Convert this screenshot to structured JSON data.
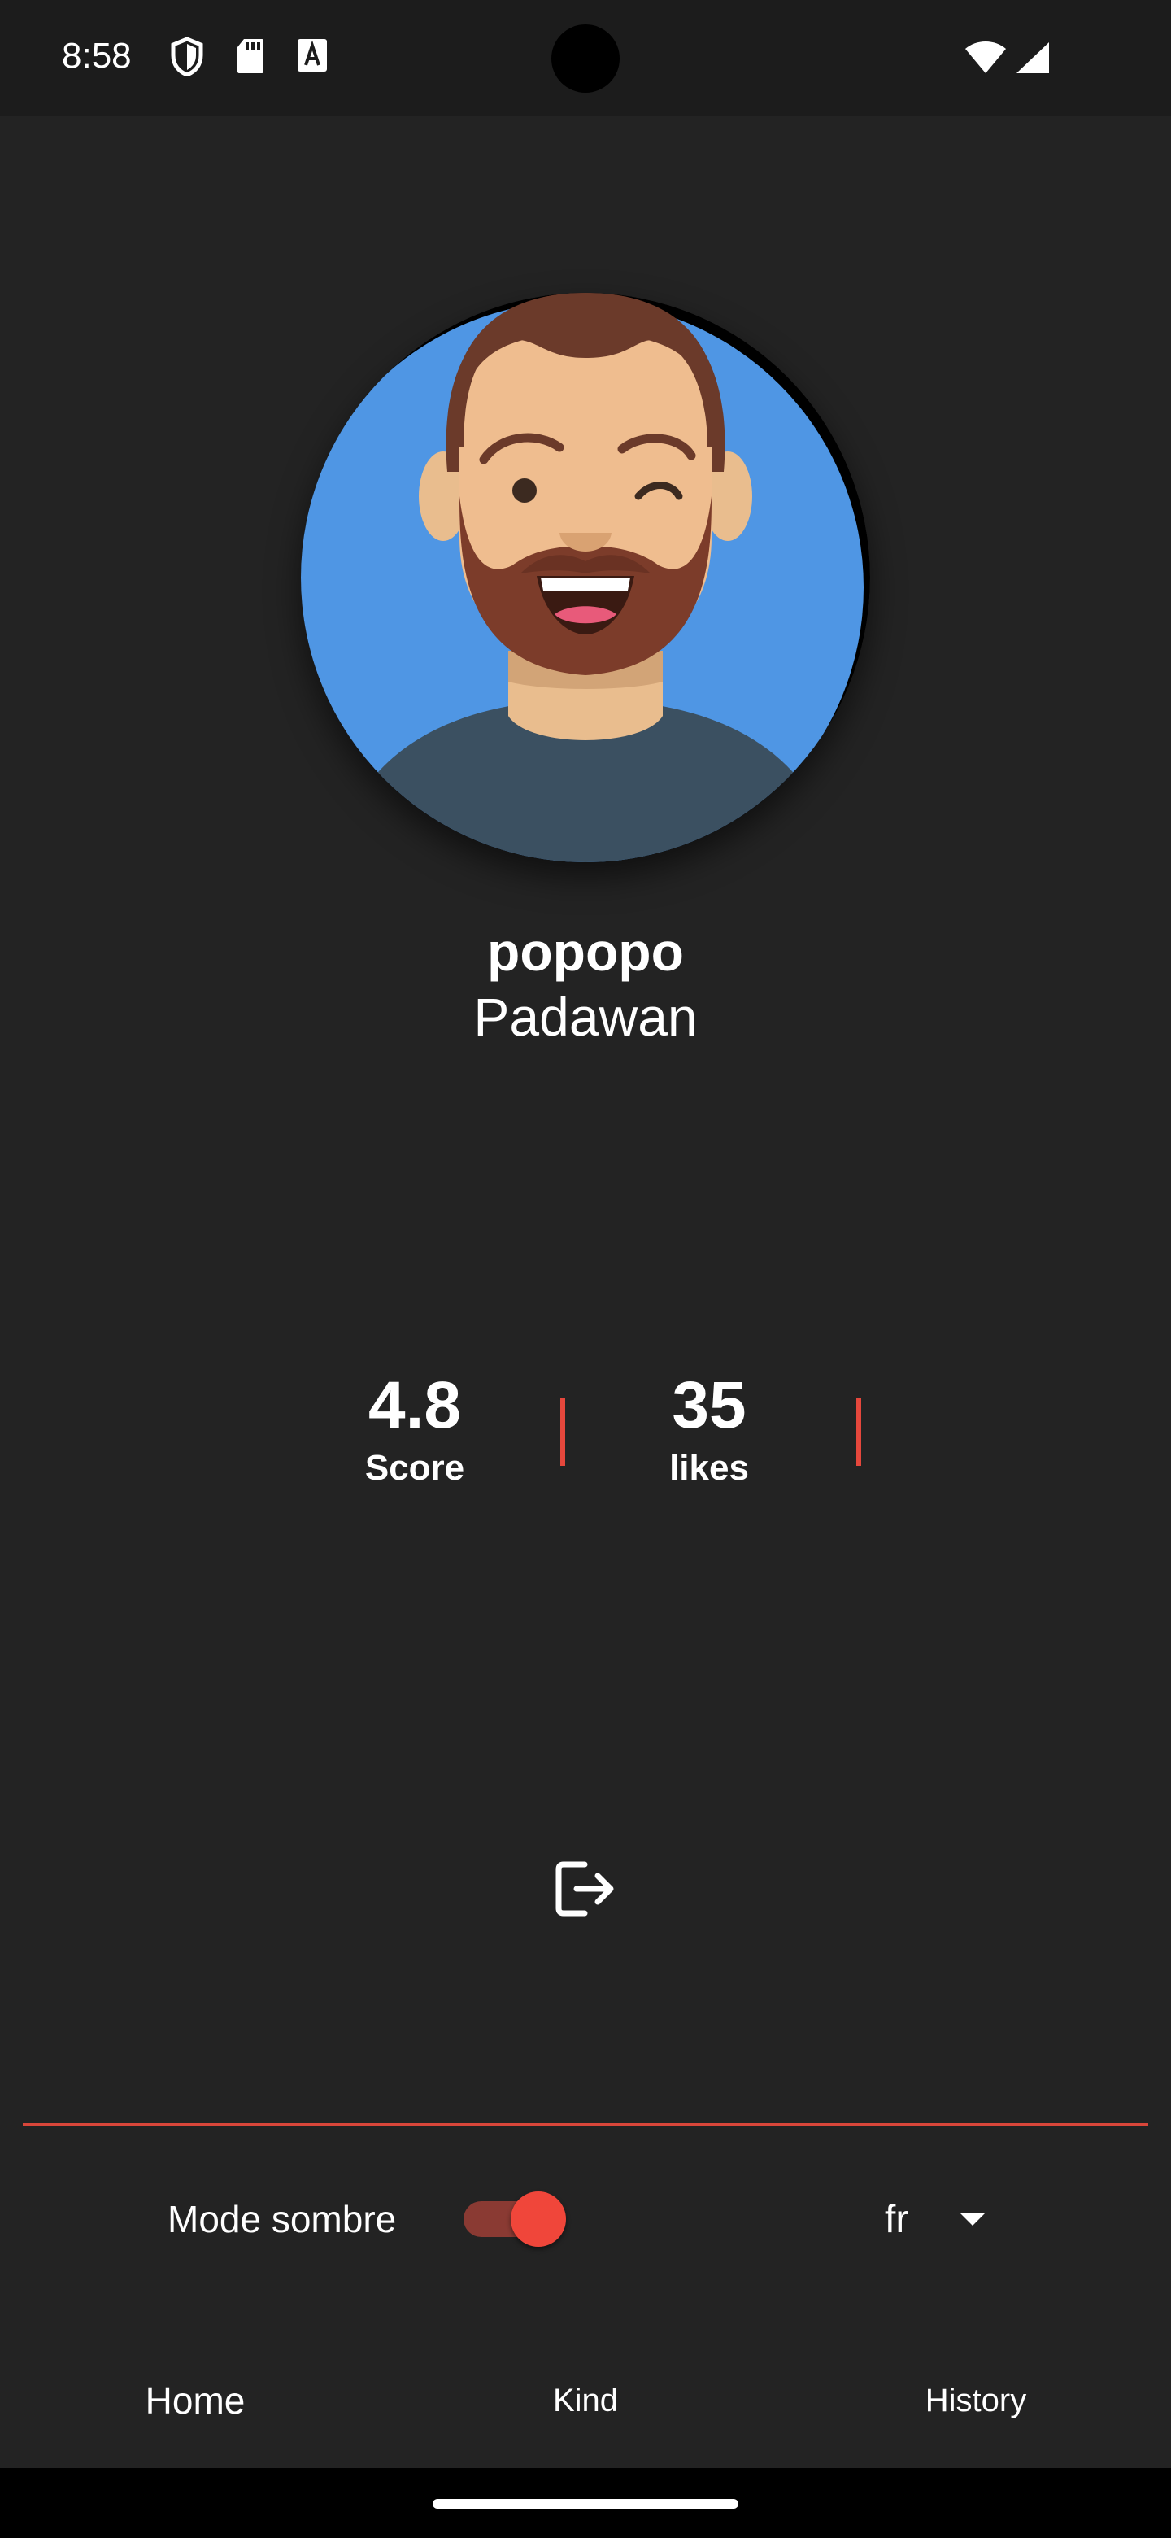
{
  "status_bar": {
    "time": "8:58",
    "icons": [
      "shield-icon",
      "sd-card-icon",
      "text-a-icon",
      "wifi-icon",
      "signal-icon"
    ]
  },
  "profile": {
    "avatar": "avatar-winking-bearded-man",
    "name": "popopo",
    "rank": "Padawan"
  },
  "stats": [
    {
      "value": "4.8",
      "label": "Score"
    },
    {
      "value": "35",
      "label": "likes"
    }
  ],
  "actions": {
    "logout_icon": "logout-icon"
  },
  "settings": {
    "dark_mode_label": "Mode sombre",
    "dark_mode_on": true,
    "language": "fr"
  },
  "bottom_nav": {
    "items": [
      {
        "label": "Home",
        "active": true
      },
      {
        "label": "Kind",
        "active": false
      },
      {
        "label": "History",
        "active": false
      }
    ]
  },
  "colors": {
    "background": "#232323",
    "accent": "#f0463a",
    "avatar_bg": "#4f96e4"
  }
}
